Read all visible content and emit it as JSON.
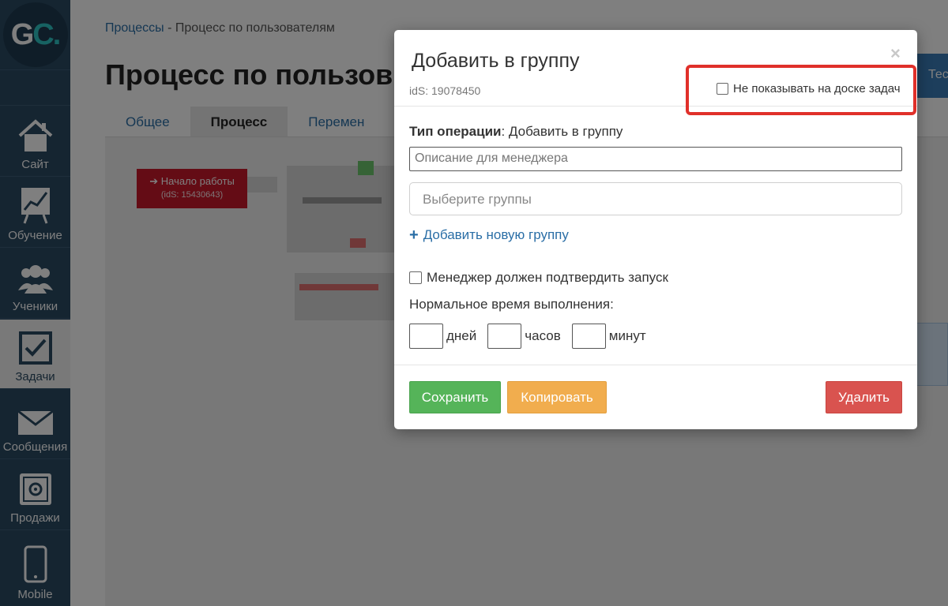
{
  "sidebar": {
    "logo": {
      "g": "G",
      "c": "C",
      "dot": "."
    },
    "items": [
      {
        "label": "Сайт",
        "icon": "home-icon"
      },
      {
        "label": "Обучение",
        "icon": "chart-board-icon"
      },
      {
        "label": "Ученики",
        "icon": "users-icon"
      },
      {
        "label": "Задачи",
        "icon": "checkbox-icon",
        "active": true
      },
      {
        "label": "Сообщения",
        "icon": "envelope-icon"
      },
      {
        "label": "Продажи",
        "icon": "safe-icon"
      },
      {
        "label": "Mobile",
        "icon": "mobile-icon"
      }
    ]
  },
  "breadcrumb": {
    "link": "Процессы",
    "separator": " - ",
    "current": "Процесс по пользователям"
  },
  "page": {
    "title": "Процесс по пользов",
    "top_right_button": "Тес",
    "tabs": [
      {
        "label": "Общее"
      },
      {
        "label": "Процесс",
        "active": true
      },
      {
        "label": "Перемен"
      }
    ],
    "start_node": {
      "label": "Начало работы",
      "ids": "(idS: 15430643)"
    }
  },
  "modal": {
    "title": "Добавить в группу",
    "ids": "idS: 19078450",
    "close": "×",
    "hide_on_board_label": "Не показывать на доске задач",
    "operation_type_label": "Тип операции",
    "operation_type_value": ": Добавить в группу",
    "description_placeholder": "Описание для менеджера",
    "groups_placeholder": "Выберите группы",
    "add_group_link": "Добавить новую группу",
    "manager_confirm_label": "Менеджер должен подтвердить запуск",
    "normal_time_label": "Нормальное время выполнения:",
    "time_units": {
      "days": "дней",
      "hours": "часов",
      "minutes": "минут"
    },
    "buttons": {
      "save": "Сохранить",
      "copy": "Копировать",
      "delete": "Удалить"
    }
  },
  "colors": {
    "sidebar_bg": "#2b4a63",
    "save": "#55b459",
    "copy": "#f1ad4e",
    "delete": "#d9534f",
    "highlight": "#e0302a",
    "link": "#2a6ea6"
  }
}
